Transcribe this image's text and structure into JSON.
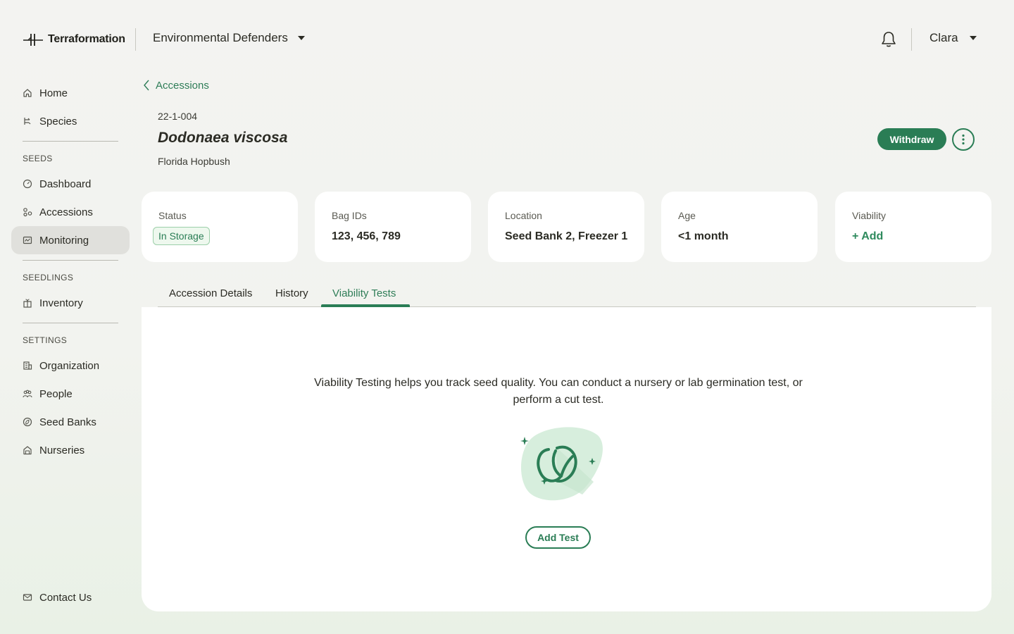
{
  "brand": {
    "name": "Terraformation"
  },
  "header": {
    "organization": "Environmental Defenders",
    "user": "Clara"
  },
  "sidebar": {
    "items_top": [
      {
        "label": "Home",
        "icon": "home-icon"
      },
      {
        "label": "Species",
        "icon": "species-icon"
      }
    ],
    "seeds_section": "SEEDS",
    "seeds_items": [
      {
        "label": "Dashboard",
        "icon": "dashboard-icon"
      },
      {
        "label": "Accessions",
        "icon": "accessions-icon"
      },
      {
        "label": "Monitoring",
        "icon": "monitoring-icon",
        "active": true
      }
    ],
    "seedlings_section": "SEEDLINGS",
    "seedlings_items": [
      {
        "label": "Inventory",
        "icon": "inventory-icon"
      }
    ],
    "settings_section": "SETTINGS",
    "settings_items": [
      {
        "label": "Organization",
        "icon": "organization-icon"
      },
      {
        "label": "People",
        "icon": "people-icon"
      },
      {
        "label": "Seed Banks",
        "icon": "seed-bank-icon"
      },
      {
        "label": "Nurseries",
        "icon": "nursery-icon"
      }
    ],
    "contact": {
      "label": "Contact Us",
      "icon": "mail-icon"
    }
  },
  "breadcrumb": {
    "label": "Accessions"
  },
  "accession": {
    "number": "22-1-004",
    "species": "Dodonaea viscosa",
    "common_name": "Florida Hopbush"
  },
  "actions": {
    "withdraw": "Withdraw"
  },
  "cards": {
    "status": {
      "label": "Status",
      "value": "In Storage"
    },
    "bag_ids": {
      "label": "Bag IDs",
      "value": "123, 456, 789"
    },
    "location": {
      "label": "Location",
      "value": "Seed Bank 2, Freezer 1"
    },
    "age": {
      "label": "Age",
      "value": "<1 month"
    },
    "viability": {
      "label": "Viability",
      "value": "+ Add"
    }
  },
  "tabs": [
    {
      "label": "Accession Details"
    },
    {
      "label": "History"
    },
    {
      "label": "Viability Tests",
      "active": true
    }
  ],
  "empty_state": {
    "text": "Viability Testing helps you track seed quality. You can conduct a nursery or lab germination test, or perform a cut test.",
    "button": "Add Test"
  },
  "colors": {
    "accent": "#2a7d55",
    "background": "#f3f3f1",
    "active_nav": "#e0e0dc"
  }
}
